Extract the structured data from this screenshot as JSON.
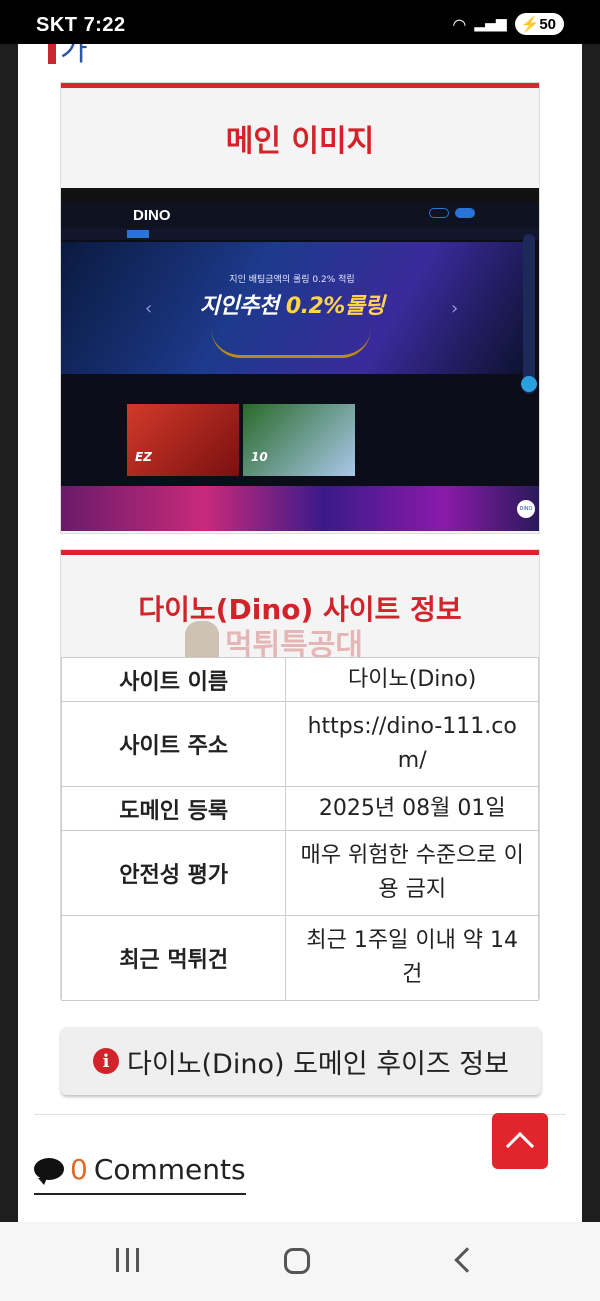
{
  "status_bar": {
    "carrier": "SKT",
    "time": "7:22",
    "battery": "50"
  },
  "main_image_card": {
    "title": "메인 이미지",
    "screenshot": {
      "logo": "DINO",
      "banner_subtitle": "지인 배팅금액의 롤링 0.2% 적립",
      "banner_title_prefix": "지인추천",
      "banner_title_highlight": "0.2%롤링",
      "card1_label": "EZ",
      "card2_label": "10"
    }
  },
  "site_info": {
    "title": "다이노(Dino) 사이트 정보",
    "watermark": "먹튀특공대",
    "rows": [
      {
        "label": "사이트 이름",
        "value": "다이노(Dino)"
      },
      {
        "label": "사이트 주소",
        "value": "https://dino-111.com/"
      },
      {
        "label": "도메인 등록",
        "value": "2025년 08월 01일"
      },
      {
        "label": "안전성 평가",
        "value": "매우 위험한 수준으로 이용 금지"
      },
      {
        "label": "최근 먹튀건",
        "value": "최근 1주일 이내 약 14건"
      }
    ]
  },
  "whois_button": {
    "icon": "info-icon",
    "label": "다이노(Dino) 도메인 후이즈 정보"
  },
  "comments": {
    "count": "0",
    "label": "Comments"
  },
  "colors": {
    "accent_red": "#d2232a",
    "comment_count": "#e06a2a"
  }
}
